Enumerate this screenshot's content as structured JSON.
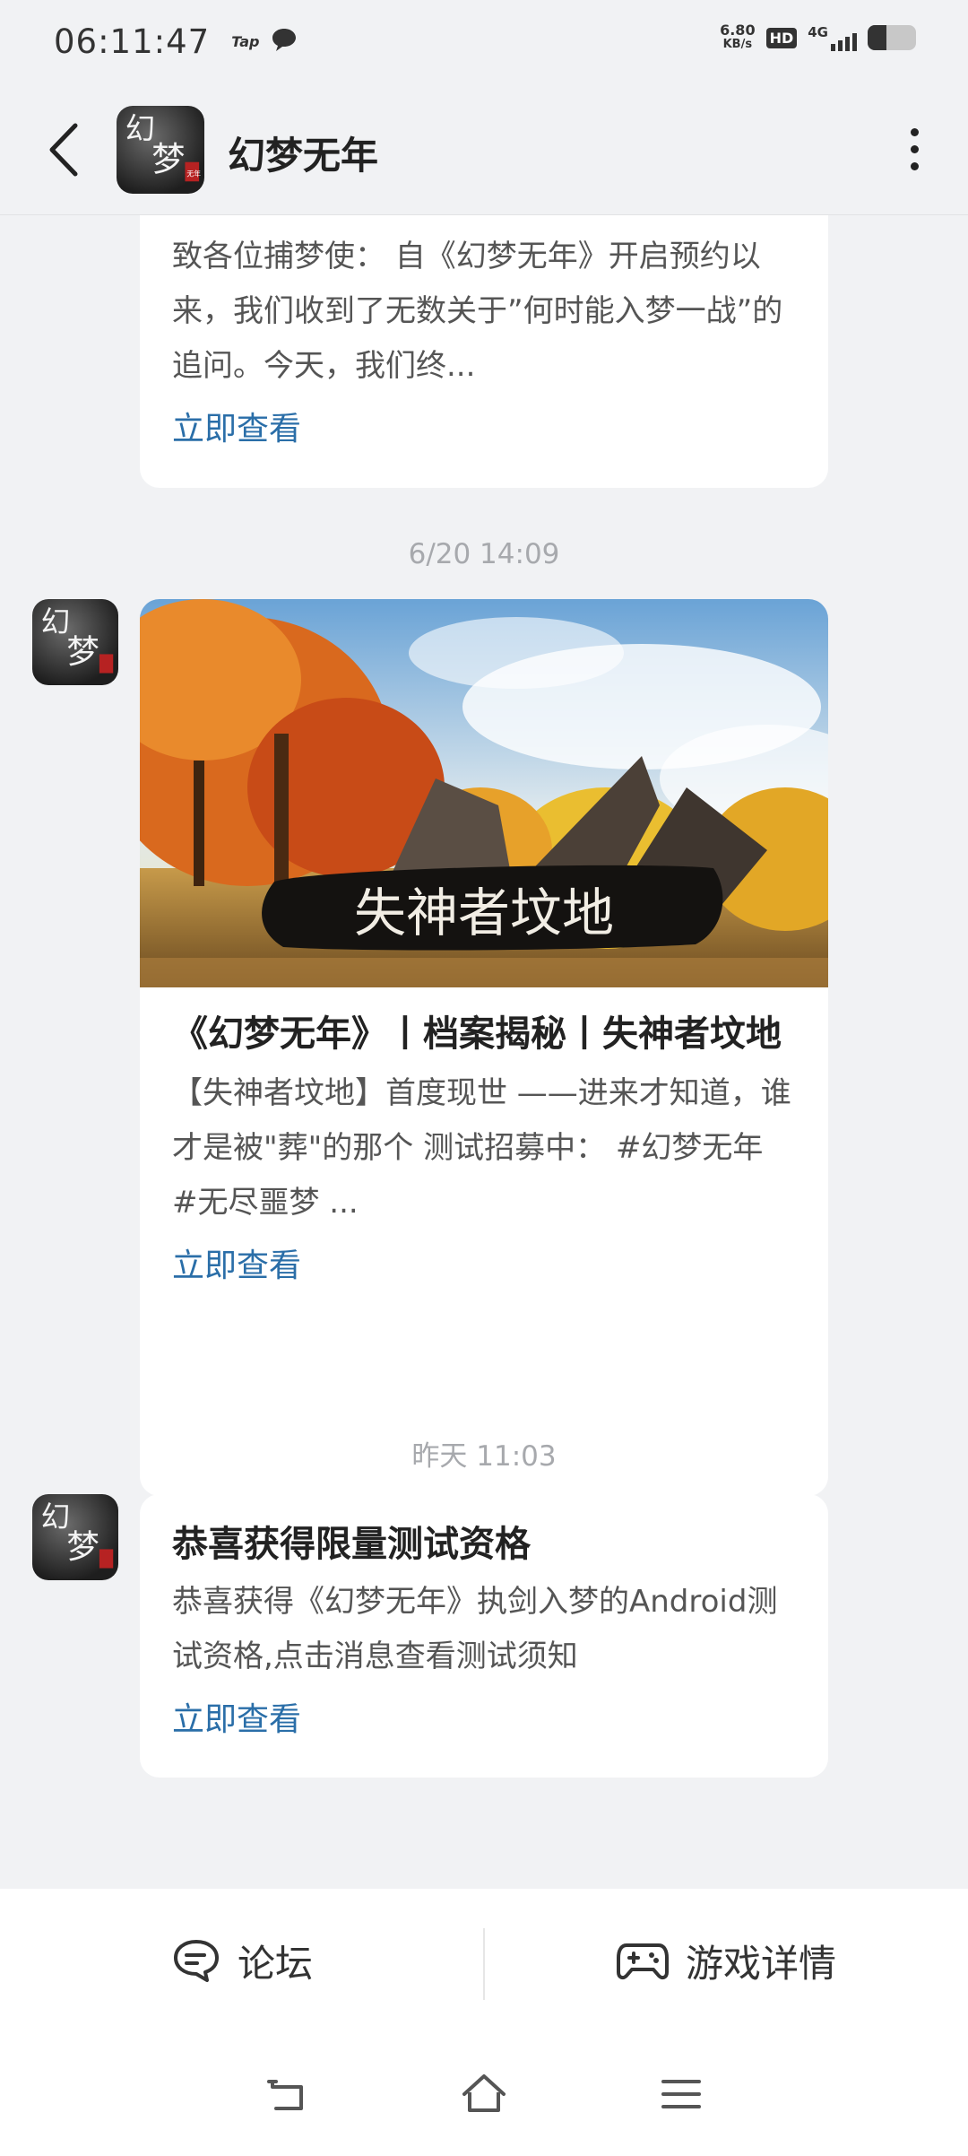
{
  "status_bar": {
    "time": "06:11:47",
    "tap_label": "Tap",
    "net_speed_value": "6.80",
    "net_speed_unit": "KB/s",
    "hd_label": "HD",
    "network_label": "4G",
    "battery_level": 0.38
  },
  "header": {
    "title": "幻梦无年",
    "logo_chars": [
      "幻",
      "梦",
      "无年"
    ]
  },
  "messages": [
    {
      "body": "致各位捕梦使： 自《幻梦无年》开启预约以来，我们收到了无数关于”何时能入梦一战”的追问。今天，我们终...",
      "link": "立即查看"
    },
    {
      "timestamp": "6/20  14:09",
      "banner_caption": "失神者坟地",
      "title": "《幻梦无年》丨档案揭秘丨失神者坟地",
      "body": "【失神者坟地】首度现世 ——进来才知道，谁才是被\"葬\"的那个 测试招募中： #幻梦无年 #无尽噩梦 ...",
      "link": "立即查看"
    },
    {
      "timestamp": "昨天  11:03",
      "title": "恭喜获得限量测试资格",
      "body": "恭喜获得《幻梦无年》执剑入梦的Android测试资格,点击消息查看测试须知",
      "link": "立即查看"
    }
  ],
  "bottom_bar": {
    "forum_label": "论坛",
    "game_detail_label": "游戏详情"
  },
  "colors": {
    "background": "#f1f2f4",
    "link": "#2a6ea8",
    "timestamp": "#a7a9ad"
  }
}
